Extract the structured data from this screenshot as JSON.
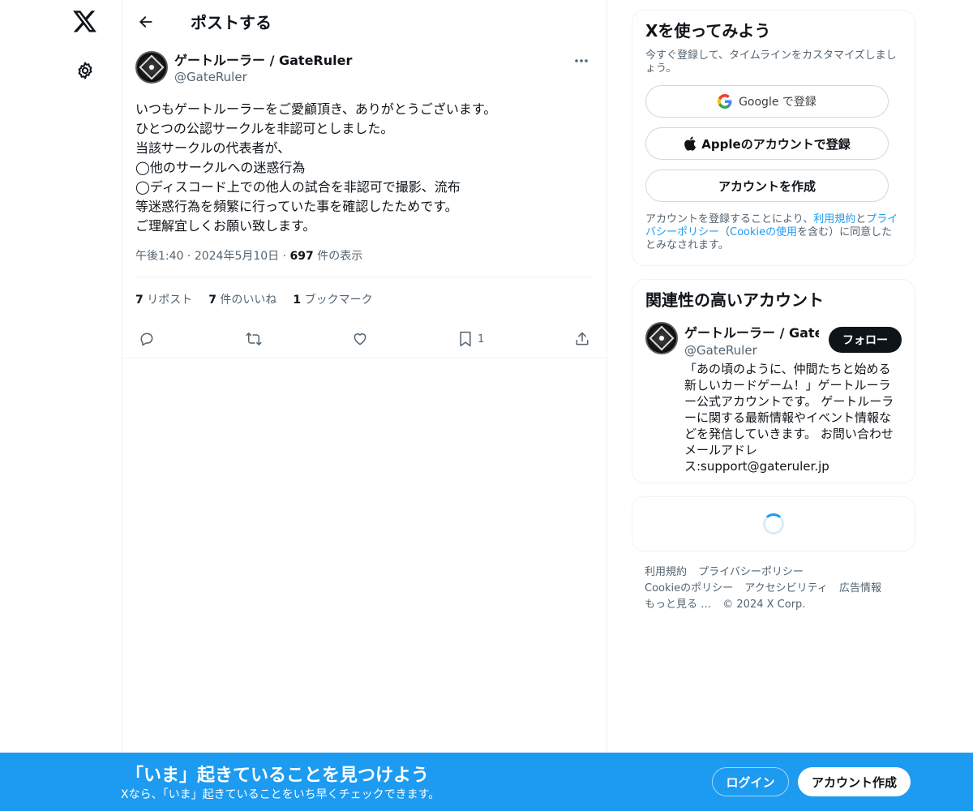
{
  "nav": {
    "logo_icon": "x-logo-icon",
    "settings_icon": "gear-icon"
  },
  "header": {
    "title": "ポストする"
  },
  "tweet": {
    "author_name": "ゲートルーラー / GateRuler",
    "author_handle": "@GateRuler",
    "text": "いつもゲートルーラーをご愛顧頂き、ありがとうございます。\nひとつの公認サークルを非認可としました。\n当該サークルの代表者が、\n◯他のサークルへの迷惑行為\n◯ディスコード上での他人の試合を非認可で撮影、流布\n等迷惑行為を頻繁に行っていた事を確認したためです。\nご理解宜しくお願い致します。",
    "time": "午後1:40",
    "date": "2024年5月10日",
    "views_count": "697",
    "views_label": "件の表示",
    "reposts_count": "7",
    "reposts_label": "リポスト",
    "likes_count": "7",
    "likes_label": "件のいいね",
    "bookmarks_count": "1",
    "bookmarks_label": "ブックマーク",
    "bookmark_action_count": "1"
  },
  "signup_card": {
    "title": "Xを使ってみよう",
    "subtitle": "今すぐ登録して、タイムラインをカスタマイズしましょう。",
    "google_label": "Google で登録",
    "apple_label": "Appleのアカウントで登録",
    "create_label": "アカウントを作成",
    "legal_prefix": "アカウントを登録することにより、",
    "legal_terms": "利用規約",
    "legal_and": "と",
    "legal_privacy": "プライバシーポリシー",
    "legal_paren_open": "（",
    "legal_cookie": "Cookieの使用",
    "legal_suffix": "を含む）に同意したとみなされます。"
  },
  "related_card": {
    "title": "関連性の高いアカウント",
    "name": "ゲートルーラー / GateRuler",
    "handle": "@GateRuler",
    "follow_label": "フォロー",
    "bio": "「あの頃のように、仲間たちと始める新しいカードゲーム！」ゲートルーラー公式アカウントです。 ゲートルーラーに関する最新情報やイベント情報などを発信していきます。 お問い合わせメールアドレス:support@gateruler.jp"
  },
  "footer": {
    "terms": "利用規約",
    "privacy": "プライバシーポリシー",
    "cookie": "Cookieのポリシー",
    "accessibility": "アクセシビリティ",
    "ads": "広告情報",
    "more": "もっと見る …",
    "copyright": "© 2024 X Corp."
  },
  "banner": {
    "title": "「いま」起きていることを見つけよう",
    "subtitle": "Xなら、「いま」起きていることをいち早くチェックできます。",
    "login_label": "ログイン",
    "signup_label": "アカウント作成",
    "background_color": "#1d9bf0"
  }
}
